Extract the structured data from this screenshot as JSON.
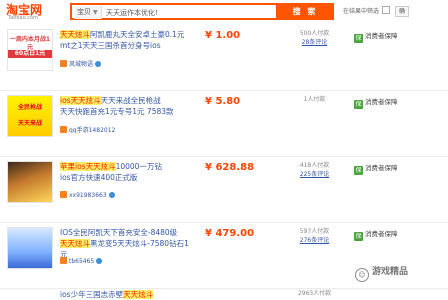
{
  "header": {
    "logo_text": "淘宝网",
    "logo_sub": "Taobao.com",
    "search_scope": "宝贝",
    "search_value": "天天运作本优化!",
    "search_button": "搜 索",
    "filter_label": "在结果中筛选",
    "ok_label": "确"
  },
  "listings": [
    {
      "thumb_label": "一周内本月战1元",
      "thumb_label2": "60点日1元",
      "title_hl": "天天炫斗",
      "title_rest": "阿凯鹿丸天全安卓土豪0.1元",
      "title_line2": "mt之1天天三国杀首分身号ios",
      "title_line3": "",
      "seller": "风城物语",
      "price": "¥ 1.00",
      "stats_line1": "500人付款",
      "stats_line2": "28条评论",
      "service_label": "消费者保障"
    },
    {
      "thumb_label": "全民枪战",
      "thumb_label2": "天天来战",
      "title_hl": "ios天天炫斗",
      "title_rest": "天天来战全民枪战",
      "title_line2": "天天快跑首充1元",
      "title_line3": "专号1元 7583款",
      "seller": "qq手游1482012",
      "price": "¥ 5.80",
      "stats_line1": "1人付款",
      "stats_line2": "",
      "service_label": "消费者保障"
    },
    {
      "thumb_label": "",
      "thumb_label2": "",
      "title_hl": "苹果ios天天炫斗",
      "title_rest": "10000一万钻",
      "title_line2": "ios官方快速400正式版",
      "title_line3": "",
      "seller": "xx91983663",
      "price": "¥ 628.88",
      "stats_line1": "418人付款",
      "stats_line2": "225条评论",
      "service_label": "消费者保障"
    },
    {
      "thumb_label": "",
      "thumb_label2": "",
      "title_hl": "天天炫斗",
      "title_rest": "IOS全民阿凯天下首充安全-8480级",
      "title_line2": "黑龙变5天天炫斗-7580钻石1元",
      "title_line3": "",
      "seller": "tb65465",
      "price": "¥ 479.00",
      "stats_line1": "597人付款",
      "stats_line2": "276条评论",
      "service_label": "消费者保障"
    },
    {
      "thumb_label": "",
      "thumb_label2": "",
      "title_hl": "天天炫斗",
      "title_rest": "ios少年三国志赤壁",
      "title_line2": "",
      "title_line3": "",
      "seller": "",
      "price": "",
      "stats_line1": "2963人付款",
      "stats_line2": "",
      "service_label": ""
    }
  ],
  "watermark": {
    "text": "游戏精品"
  }
}
